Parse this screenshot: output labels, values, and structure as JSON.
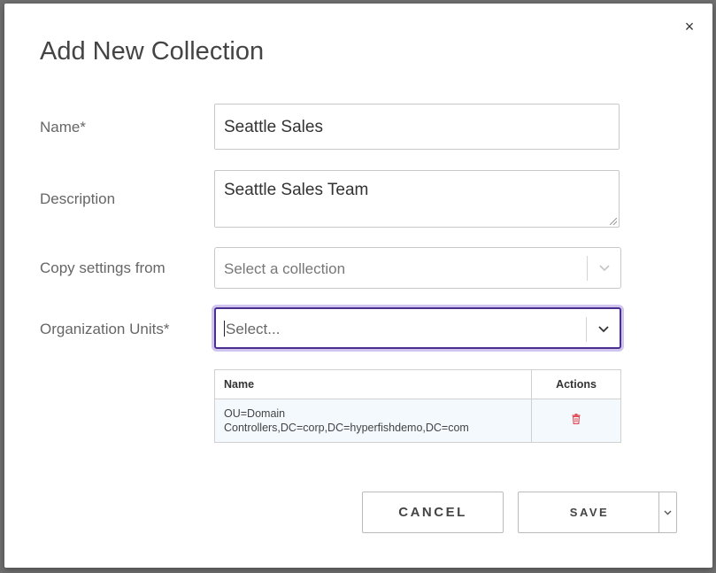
{
  "dialog": {
    "title": "Add New Collection",
    "close_label": "×"
  },
  "form": {
    "name": {
      "label": "Name*",
      "value": "Seattle Sales"
    },
    "description": {
      "label": "Description",
      "value": "Seattle Sales Team"
    },
    "copy_settings": {
      "label": "Copy settings from",
      "placeholder": "Select a collection"
    },
    "org_units": {
      "label": "Organization Units*",
      "placeholder": "Select..."
    }
  },
  "ou_table": {
    "columns": {
      "name": "Name",
      "actions": "Actions"
    },
    "rows": [
      {
        "name": "OU=Domain Controllers,DC=corp,DC=hyperfishdemo,DC=com",
        "action_icon": "trash-icon"
      }
    ]
  },
  "buttons": {
    "cancel": "CANCEL",
    "save": "SAVE"
  },
  "colors": {
    "focus_border": "#4b2f8f",
    "delete_icon": "#e0414a",
    "row_background": "#f3f9fd"
  }
}
